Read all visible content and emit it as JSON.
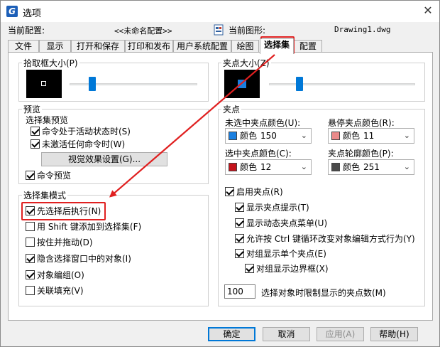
{
  "window": {
    "title": "选项",
    "app_icon_glyph": "G",
    "close_glyph": "✕"
  },
  "info": {
    "current_config_label": "当前配置:",
    "current_config_value": "<<未命名配置>>",
    "current_drawing_label": "当前图形:",
    "current_drawing_value": "Drawing1.dwg"
  },
  "tabs": [
    "文件",
    "显示",
    "打开和保存",
    "打印和发布",
    "用户系统配置",
    "绘图",
    "选择集",
    "配置"
  ],
  "active_tab": "选择集",
  "pickbox": {
    "title": "拾取框大小(P)",
    "slider_level": 0.3
  },
  "grip_size": {
    "title": "夹点大小(Z)",
    "slider_level": 0.38
  },
  "preview": {
    "title": "预览",
    "subtitle": "选择集预览",
    "when_command_active": "命令处于活动状态时(S)",
    "when_no_command": "未激活任何命令时(W)",
    "visual_effects_button": "视觉效果设置(G)...",
    "command_preview": "命令预览"
  },
  "selection_modes": {
    "title": "选择集模式",
    "items": [
      {
        "label": "先选择后执行(N)",
        "checked": true
      },
      {
        "label": "用 Shift 键添加到选择集(F)",
        "checked": false
      },
      {
        "label": "按住并拖动(D)",
        "checked": false
      },
      {
        "label": "隐含选择窗口中的对象(I)",
        "checked": true
      },
      {
        "label": "对象编组(O)",
        "checked": true
      },
      {
        "label": "关联填充(V)",
        "checked": false
      }
    ]
  },
  "grips": {
    "title": "夹点",
    "unselected_color_label": "未选中夹点颜色(U):",
    "hover_color_label": "悬停夹点颜色(R):",
    "selected_color_label": "选中夹点颜色(C):",
    "outline_color_label": "夹点轮廓颜色(P):",
    "color_word": "颜色",
    "unselected_color": {
      "value": "150",
      "hex": "#1a7fe0"
    },
    "hover_color": {
      "value": "11",
      "hex": "#ea8a8a"
    },
    "selected_color": {
      "value": "12",
      "hex": "#c4121b"
    },
    "outline_color": {
      "value": "251",
      "hex": "#4a4a4a"
    },
    "enable_grips": "启用夹点(R)",
    "show_grip_tips": "显示夹点提示(T)",
    "show_dynamic_menu": "显示动态夹点菜单(U)",
    "allow_ctrl_cycle": "允许按 Ctrl 键循环改变对象编辑方式行为(Y)",
    "show_single_grip_groups": "对组显示单个夹点(E)",
    "show_bbox_groups": "对组显示边界框(X)",
    "object_limit_value": "100",
    "object_limit_label": "选择对象时限制显示的夹点数(M)"
  },
  "buttons": {
    "ok": "确定",
    "cancel": "取消",
    "apply": "应用(A)",
    "help": "帮助(H)"
  },
  "colors": {
    "highlight_red": "#e02020",
    "accent_blue": "#0078d7"
  }
}
